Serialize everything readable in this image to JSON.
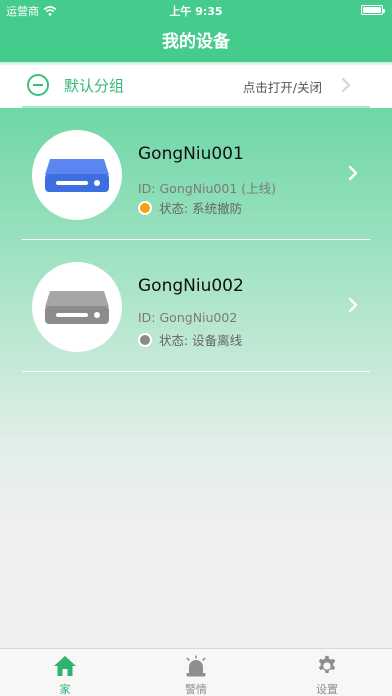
{
  "status_bar": {
    "carrier": "运营商",
    "time": "上午 9:35"
  },
  "header": {
    "title": "我的设备"
  },
  "group": {
    "name": "默认分组",
    "toggle_hint": "点击打开/关闭",
    "icon": "collapse-icon"
  },
  "devices": [
    {
      "name": "GongNiu001",
      "id_text": "ID: GongNiu001 (上线)",
      "status_text": "状态: 系统撤防",
      "status_color": "#f4a014",
      "device_color": "#3d6fe0"
    },
    {
      "name": "GongNiu002",
      "id_text": "ID: GongNiu002",
      "status_text": "状态: 设备离线",
      "status_color": "#8a8a8a",
      "device_color": "#8c8c8c"
    }
  ],
  "tabs": [
    {
      "label": "家",
      "icon": "home-icon",
      "active": true
    },
    {
      "label": "警情",
      "icon": "alarm-icon",
      "active": false
    },
    {
      "label": "设置",
      "icon": "gear-icon",
      "active": false
    }
  ],
  "colors": {
    "brand_green": "#45cc8c",
    "active_tab": "#2fb36f",
    "inactive_tab": "#8e8e8e"
  }
}
